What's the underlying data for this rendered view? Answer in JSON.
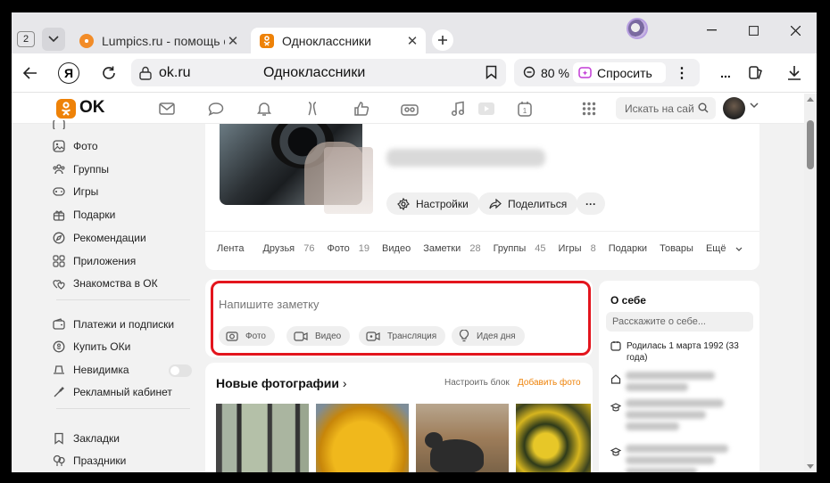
{
  "browser": {
    "tab_count": "2",
    "tabs": [
      {
        "title": "Lumpics.ru - помощь с компьютером",
        "active": false
      },
      {
        "title": "Одноклассники",
        "active": true
      }
    ],
    "url_host": "ok.ru",
    "page_title": "Одноклассники",
    "zoom": "80 %",
    "ask_label": "Спросить",
    "more_label": "..."
  },
  "colors": {
    "accent": "#ee8208",
    "highlight": "#e3151d"
  },
  "ok_header": {
    "logo_text": "OK",
    "nav_icons": [
      "mail-icon",
      "chat-icon",
      "bell-icon",
      "guests-icon",
      "like-icon",
      "friends-icon",
      "music-icon",
      "video-icon",
      "calendar-icon",
      "apps-icon"
    ],
    "search_placeholder": "Искать на сайте"
  },
  "sidebar": {
    "items": [
      {
        "label": "Фото",
        "icon": "photo-icon"
      },
      {
        "label": "Группы",
        "icon": "groups-icon"
      },
      {
        "label": "Игры",
        "icon": "gamepad-icon"
      },
      {
        "label": "Подарки",
        "icon": "gift-icon"
      },
      {
        "label": "Рекомендации",
        "icon": "compass-icon"
      },
      {
        "label": "Приложения",
        "icon": "apps-icon"
      },
      {
        "label": "Знакомства в ОК",
        "icon": "hearts-icon"
      },
      {
        "label": "Платежи и подписки",
        "icon": "wallet-icon"
      },
      {
        "label": "Купить ОКи",
        "icon": "coin-icon"
      },
      {
        "label": "Невидимка",
        "icon": "hat-icon"
      },
      {
        "label": "Рекламный кабинет",
        "icon": "megaphone-icon"
      },
      {
        "label": "Закладки",
        "icon": "bookmark-icon"
      },
      {
        "label": "Праздники",
        "icon": "balloon-icon"
      }
    ]
  },
  "profile": {
    "buttons": {
      "settings": "Настройки",
      "share": "Поделиться",
      "more": "···"
    },
    "tabs": [
      {
        "label": "Лента",
        "count": ""
      },
      {
        "label": "Друзья",
        "count": "76"
      },
      {
        "label": "Фото",
        "count": "19"
      },
      {
        "label": "Видео",
        "count": ""
      },
      {
        "label": "Заметки",
        "count": "28"
      },
      {
        "label": "Группы",
        "count": "45"
      },
      {
        "label": "Игры",
        "count": "8"
      },
      {
        "label": "Подарки",
        "count": ""
      },
      {
        "label": "Товары",
        "count": ""
      },
      {
        "label": "Ещё",
        "count": ""
      }
    ]
  },
  "composer": {
    "placeholder": "Напишите заметку",
    "buttons": [
      {
        "label": "Фото",
        "icon": "camera-icon"
      },
      {
        "label": "Видео",
        "icon": "video-camera-icon"
      },
      {
        "label": "Трансляция",
        "icon": "broadcast-icon"
      },
      {
        "label": "Идея дня",
        "icon": "lightbulb-icon"
      }
    ]
  },
  "photos": {
    "title": "Новые фотографии",
    "arrow": "›",
    "configure": "Настроить блок",
    "add": "Добавить фото"
  },
  "about": {
    "title": "О себе",
    "placeholder": "Расскажите о себе...",
    "birthday": "Родилась 1 марта 1992 (33 года)"
  }
}
